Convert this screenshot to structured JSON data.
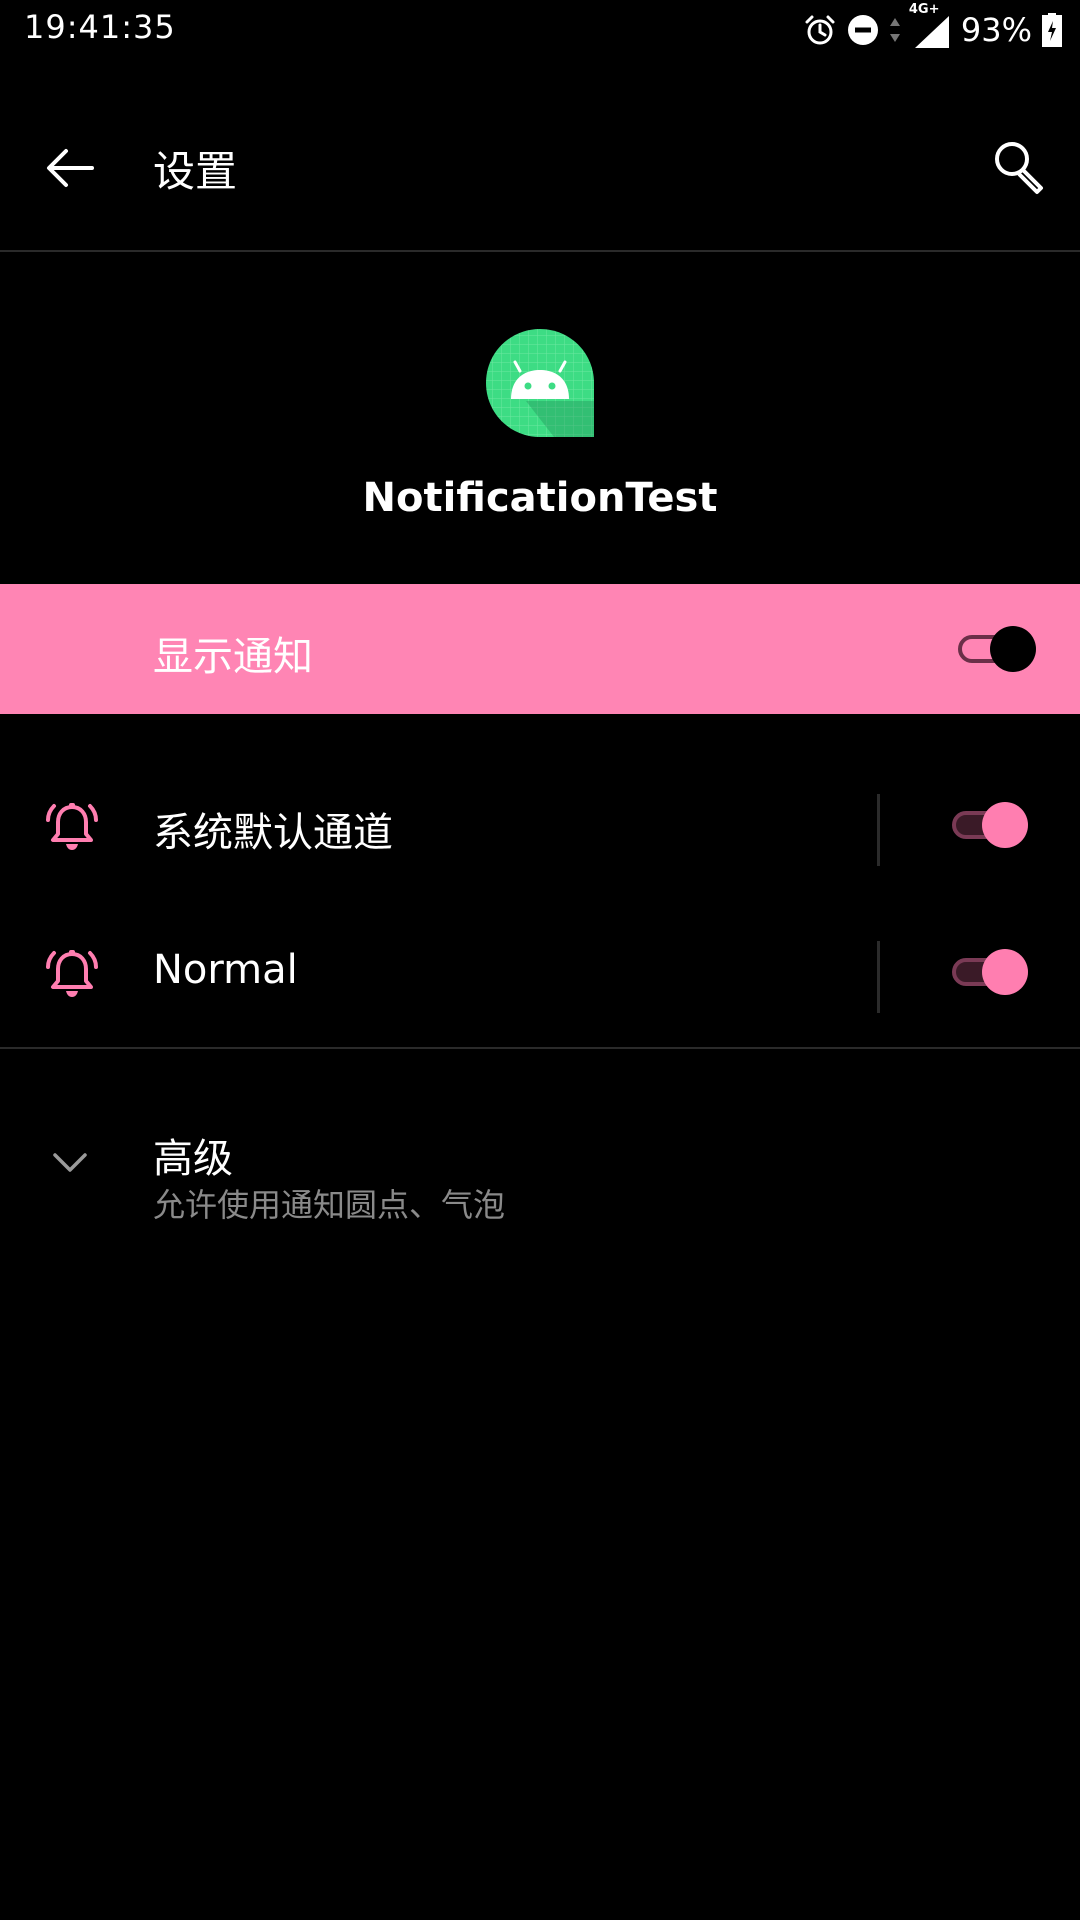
{
  "status_bar": {
    "time": "19:41:35",
    "network": "4G+",
    "battery": "93%",
    "icons": [
      "alarm-icon",
      "dnd-icon",
      "data-arrows-icon",
      "signal-icon",
      "battery-charging-icon"
    ]
  },
  "appbar": {
    "title": "设置",
    "back_icon": "back-arrow-icon",
    "search_icon": "search-icon"
  },
  "app": {
    "name": "NotificationTest",
    "icon": "android-app-icon",
    "icon_colors": {
      "bubble": "#3ddc84",
      "robot": "#ffffff"
    }
  },
  "master": {
    "label": "显示通知",
    "enabled": true,
    "row_color": "#ff85b4"
  },
  "channels": [
    {
      "label": "系统默认通道",
      "icon": "bell-icon",
      "enabled": true
    },
    {
      "label": "Normal",
      "icon": "bell-icon",
      "enabled": true
    }
  ],
  "advanced": {
    "title": "高级",
    "subtitle": "允许使用通知圆点、气泡",
    "icon": "chevron-down-icon"
  },
  "colors": {
    "accent": "#ff7eb0",
    "background": "#000000",
    "secondary_text": "#8a8a8a"
  }
}
